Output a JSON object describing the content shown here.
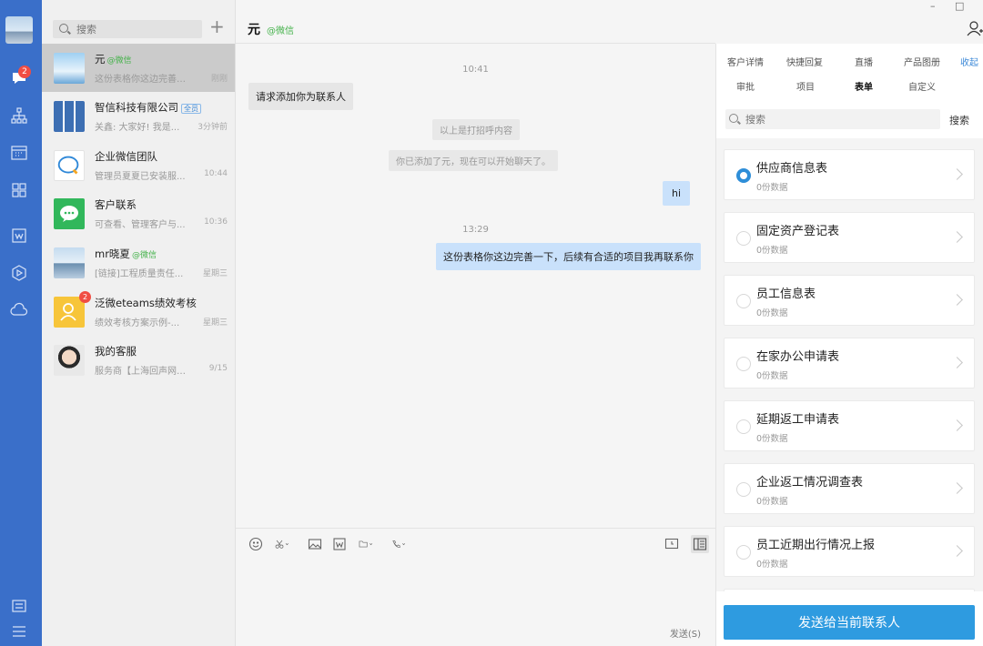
{
  "rail": {
    "badge": "2"
  },
  "list": {
    "search_placeholder": "搜索",
    "plus": "+",
    "conversations": [
      {
        "name": "元",
        "tag": "@微信",
        "preview": "这份表格你这边完善一...",
        "time": "刚刚",
        "avatar_color": "#8cc3ea"
      },
      {
        "name": "智信科技有限公司",
        "tag_box": "全员",
        "preview": "关鑫: 大家好! 我是...",
        "time": "3分钟前",
        "avatar_color": "#4a78b8"
      },
      {
        "name": "企业微信团队",
        "preview": "管理员夏夏已安装服...",
        "time": "10:44",
        "avatar_color": "#ffffff"
      },
      {
        "name": "客户联系",
        "preview": "可查看、管理客户与...",
        "time": "10:36",
        "avatar_color": "#31b75b"
      },
      {
        "name": "mr晓夏",
        "tag": "@微信",
        "preview": "[链接]工程质量责任...",
        "time": "星期三",
        "avatar_color": "#aac4de"
      },
      {
        "name": "泛微eteams绩效考核",
        "badge": "2",
        "preview": "绩效考核方案示例-...",
        "time": "星期三",
        "avatar_color": "#f7c53a"
      },
      {
        "name": "我的客服",
        "preview": "服务商【上海回声网络...",
        "time": "9/15",
        "avatar_color": "#e7d8cc"
      }
    ]
  },
  "chat": {
    "title": "元",
    "title_tag": "@微信",
    "time1": "10:41",
    "msg_request": "请求添加你为联系人",
    "sys1": "以上是打招呼内容",
    "sys2": "你已添加了元，现在可以开始聊天了。",
    "msg_hi": "hi",
    "time2": "13:29",
    "msg_form": "这份表格你这边完善一下，后续有合适的项目我再联系你",
    "send": "发送(S)"
  },
  "panel": {
    "tabs_row1": [
      "客户详情",
      "快捷回复",
      "直播",
      "产品图册",
      "收起"
    ],
    "tabs_row2": [
      "审批",
      "项目",
      "表单",
      "自定义"
    ],
    "search_placeholder": "搜索",
    "search_button": "搜索",
    "forms": [
      {
        "title": "供应商信息表",
        "sub": "0份数据",
        "selected": true
      },
      {
        "title": "固定资产登记表",
        "sub": "0份数据",
        "selected": false
      },
      {
        "title": "员工信息表",
        "sub": "0份数据",
        "selected": false
      },
      {
        "title": "在家办公申请表",
        "sub": "0份数据",
        "selected": false
      },
      {
        "title": "延期返工申请表",
        "sub": "0份数据",
        "selected": false
      },
      {
        "title": "企业返工情况调查表",
        "sub": "0份数据",
        "selected": false
      },
      {
        "title": "员工近期出行情况上报",
        "sub": "0份数据",
        "selected": false
      }
    ],
    "send_button": "发送给当前联系人"
  },
  "window": {
    "minimize": "–",
    "maximize": "□"
  }
}
